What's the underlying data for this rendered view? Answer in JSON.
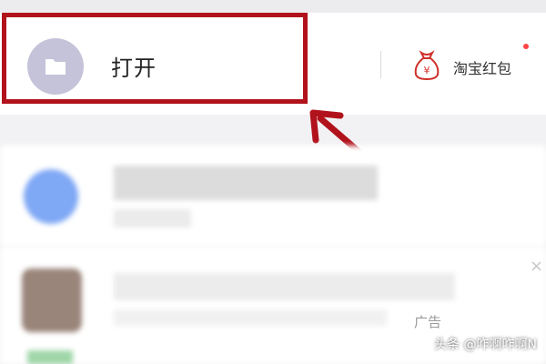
{
  "main": {
    "open_label": "打开",
    "hongbao_label": "淘宝红包",
    "ad_badge": "广告",
    "close_symbol": "×"
  },
  "icons": {
    "folder": "folder-icon",
    "money_bag": "money-bag-icon",
    "annotation_arrow": "arrow-icon"
  },
  "colors": {
    "highlight": "#b1121b",
    "folder_bg": "#c5c3d9",
    "notify_dot": "#ff4444"
  },
  "watermark": {
    "text": "头条 @咋啊咋啊N"
  }
}
